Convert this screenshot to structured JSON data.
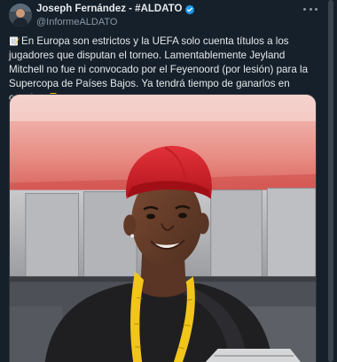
{
  "tweet": {
    "author": {
      "display_name": "Joseph Fernández - #ALDATO",
      "handle": "@InformeALDATO",
      "verified_icon": "verified-badge-icon",
      "avatar": "avatar"
    },
    "more_icon": "more-options-icon",
    "text": {
      "emoji_leading": "memo-icon",
      "body": "En Europa son estrictos y la UEFA solo cuenta títulos a los jugadores que disputan el torneo. Lamentablemente Jeyland Mitchell no fue ni convocado por el Feyenoord (por lesión) para la Supercopa de Países Bajos. Ya tendrá tiempo de ganarlos en cancha.",
      "emoji_trailing": "trophy-icon"
    },
    "media": {
      "description_icon": "photo"
    }
  },
  "colors": {
    "background": "#15202b",
    "verified": "#1d9bf0",
    "cap": "#d0202a",
    "lanyard": "#f2c51a"
  }
}
